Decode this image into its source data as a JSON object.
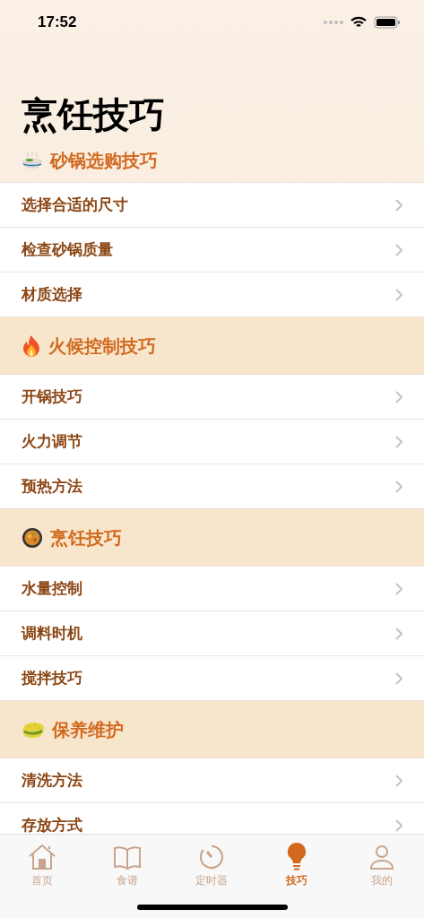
{
  "status_bar": {
    "time": "17:52"
  },
  "title": "烹饪技巧",
  "sections": [
    {
      "title": "砂锅选购技巧",
      "items": [
        {
          "label": "选择合适的尺寸"
        },
        {
          "label": "检查砂锅质量"
        },
        {
          "label": "材质选择"
        }
      ]
    },
    {
      "title": "火候控制技巧",
      "items": [
        {
          "label": "开锅技巧"
        },
        {
          "label": "火力调节"
        },
        {
          "label": "预热方法"
        }
      ]
    },
    {
      "title": "烹饪技巧",
      "items": [
        {
          "label": "水量控制"
        },
        {
          "label": "调料时机"
        },
        {
          "label": "搅拌技巧"
        }
      ]
    },
    {
      "title": "保养维护",
      "items": [
        {
          "label": "清洗方法"
        },
        {
          "label": "存放方式"
        }
      ]
    }
  ],
  "tab_bar": [
    {
      "label": "首页",
      "selected": false
    },
    {
      "label": "食谱",
      "selected": false
    },
    {
      "label": "定时器",
      "selected": false
    },
    {
      "label": "技巧",
      "selected": true
    },
    {
      "label": "我的",
      "selected": false
    }
  ]
}
